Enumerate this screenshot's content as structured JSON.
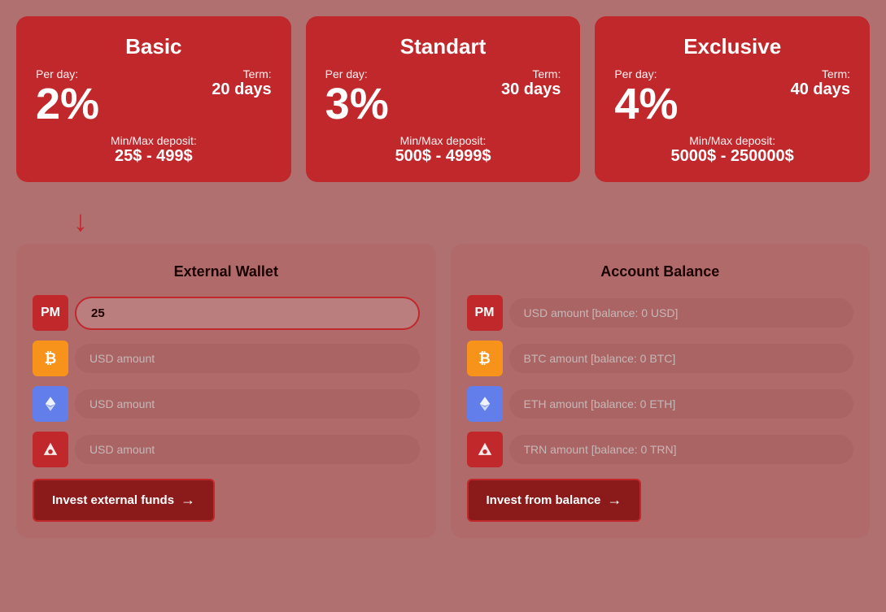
{
  "plans": [
    {
      "id": "basic",
      "title": "Basic",
      "per_day_label": "Per day:",
      "percent": "2%",
      "term_label": "Term:",
      "term_value": "20 days",
      "minmax_label": "Min/Max deposit:",
      "minmax_value": "25$ - 499$"
    },
    {
      "id": "standart",
      "title": "Standart",
      "per_day_label": "Per day:",
      "percent": "3%",
      "term_label": "Term:",
      "term_value": "30 days",
      "minmax_label": "Min/Max deposit:",
      "minmax_value": "500$ - 4999$"
    },
    {
      "id": "exclusive",
      "title": "Exclusive",
      "per_day_label": "Per day:",
      "percent": "4%",
      "term_label": "Term:",
      "term_value": "40 days",
      "minmax_label": "Min/Max deposit:",
      "minmax_value": "5000$ - 250000$"
    }
  ],
  "external_wallet": {
    "title": "External Wallet",
    "pm_icon_label": "PM",
    "pm_value": "25",
    "pm_placeholder": "",
    "btc_placeholder": "USD amount",
    "eth_placeholder": "USD amount",
    "trn_placeholder": "USD amount",
    "invest_btn_label": "Invest external funds",
    "invest_btn_arrow": "→"
  },
  "account_balance": {
    "title": "Account Balance",
    "pm_icon_label": "PM",
    "pm_placeholder": "USD amount [balance: 0 USD]",
    "btc_placeholder": "BTC amount [balance: 0 BTC]",
    "eth_placeholder": "ETH amount [balance: 0 ETH]",
    "trn_placeholder": "TRN amount [balance: 0 TRN]",
    "invest_btn_label": "Invest from balance",
    "invest_btn_arrow": "→"
  }
}
